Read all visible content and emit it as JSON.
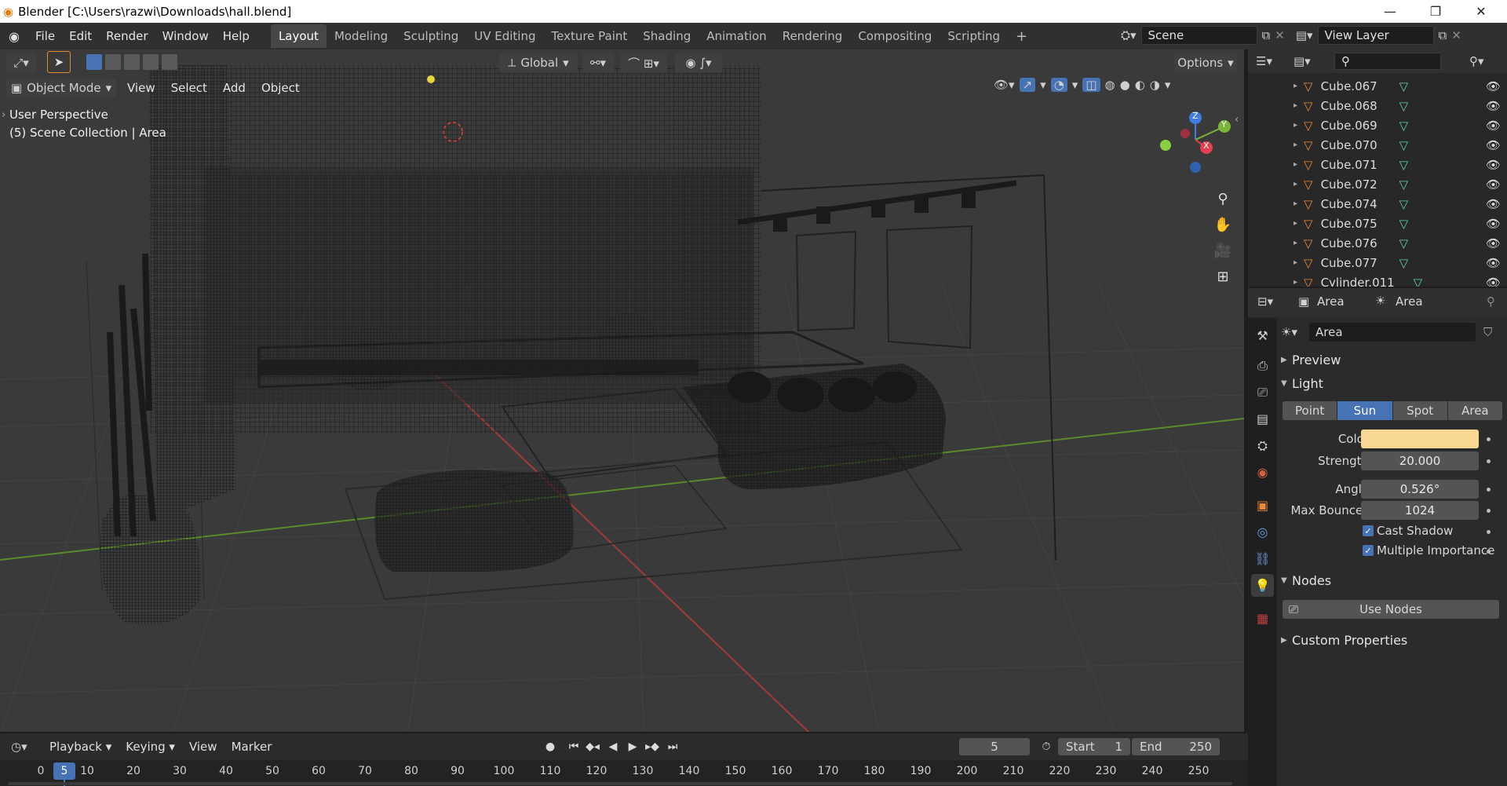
{
  "window": {
    "title": "Blender [C:\\Users\\razwi\\Downloads\\hall.blend]",
    "minimize": "—",
    "maximize": "❐",
    "close": "✕"
  },
  "menu": [
    "File",
    "Edit",
    "Render",
    "Window",
    "Help"
  ],
  "workspaces": [
    "Layout",
    "Modeling",
    "Sculpting",
    "UV Editing",
    "Texture Paint",
    "Shading",
    "Animation",
    "Rendering",
    "Compositing",
    "Scripting"
  ],
  "add_workspace": "+",
  "scene": {
    "name": "Scene",
    "view_layer": "View Layer"
  },
  "toolbar": {
    "orientation": "Global",
    "options": "Options"
  },
  "viewport": {
    "mode": "Object Mode",
    "menus": [
      "View",
      "Select",
      "Add",
      "Object"
    ],
    "info_line1": "User Perspective",
    "info_line2": "(5) Scene Collection | Area",
    "gizmo": {
      "z": "Z",
      "y": "Y",
      "x": "X"
    }
  },
  "outliner": {
    "search_placeholder": "",
    "items": [
      "Cube.067",
      "Cube.068",
      "Cube.069",
      "Cube.070",
      "Cube.071",
      "Cube.072",
      "Cube.074",
      "Cube.075",
      "Cube.076",
      "Cube.077",
      "Cylinder.011"
    ]
  },
  "properties": {
    "breadcrumb_object": "Area",
    "breadcrumb_data": "Area",
    "datablock": "Area",
    "panels": {
      "preview": "Preview",
      "light": "Light",
      "nodes": "Nodes",
      "custom": "Custom Properties"
    },
    "light_types": [
      "Point",
      "Sun",
      "Spot",
      "Area"
    ],
    "active_light_type": "Sun",
    "color_label": "Color",
    "color_value": "#f6d893",
    "strength_label": "Strength",
    "strength": "20.000",
    "angle_label": "Angle",
    "angle": "0.526°",
    "bounces_label": "Max Bounces",
    "bounces": "1024",
    "cast_shadow": "Cast Shadow",
    "multiple_importance": "Multiple Importance",
    "use_nodes": "Use Nodes"
  },
  "timeline": {
    "menus": [
      "Playback",
      "Keying",
      "View",
      "Marker"
    ],
    "current_frame": "5",
    "start_label": "Start",
    "start": "1",
    "end_label": "End",
    "end": "250",
    "ticks": [
      "0",
      "5",
      "10",
      "20",
      "30",
      "40",
      "50",
      "60",
      "70",
      "80",
      "90",
      "100",
      "110",
      "120",
      "130",
      "140",
      "150",
      "160",
      "170",
      "180",
      "190",
      "200",
      "210",
      "220",
      "230",
      "240",
      "250"
    ]
  },
  "colors": {
    "accent": "#4772b3",
    "mesh_icon": "#e8883a",
    "data_icon": "#5fd0a0"
  }
}
